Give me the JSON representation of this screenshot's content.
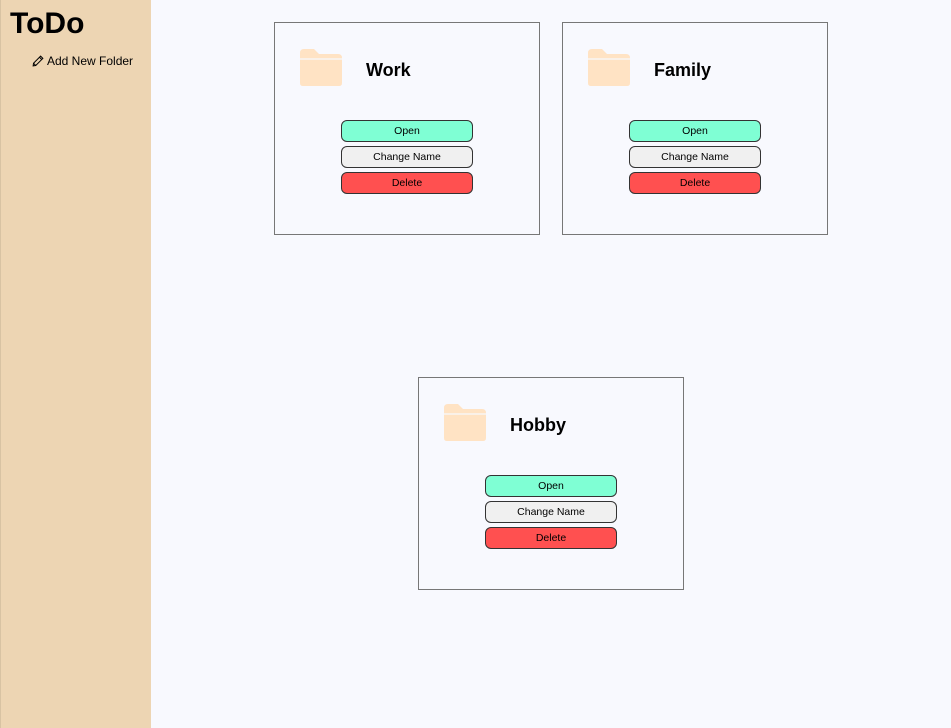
{
  "app": {
    "title": "ToDo"
  },
  "sidebar": {
    "add_folder_label": "Add New Folder",
    "add_folder_icon": "pencil-icon"
  },
  "folders": [
    {
      "name": "Work",
      "icon": "folder-icon",
      "open_label": "Open",
      "rename_label": "Change Name",
      "delete_label": "Delete"
    },
    {
      "name": "Family",
      "icon": "folder-icon",
      "open_label": "Open",
      "rename_label": "Change Name",
      "delete_label": "Delete"
    },
    {
      "name": "Hobby",
      "icon": "folder-icon",
      "open_label": "Open",
      "rename_label": "Change Name",
      "delete_label": "Delete"
    }
  ],
  "colors": {
    "sidebar_bg": "#edd5b3",
    "page_bg": "#f8f9fe",
    "folder_icon": "#ffe3c4",
    "open_button": "#7fffd4",
    "rename_button": "#f0f0f0",
    "delete_button": "#ff5050"
  }
}
